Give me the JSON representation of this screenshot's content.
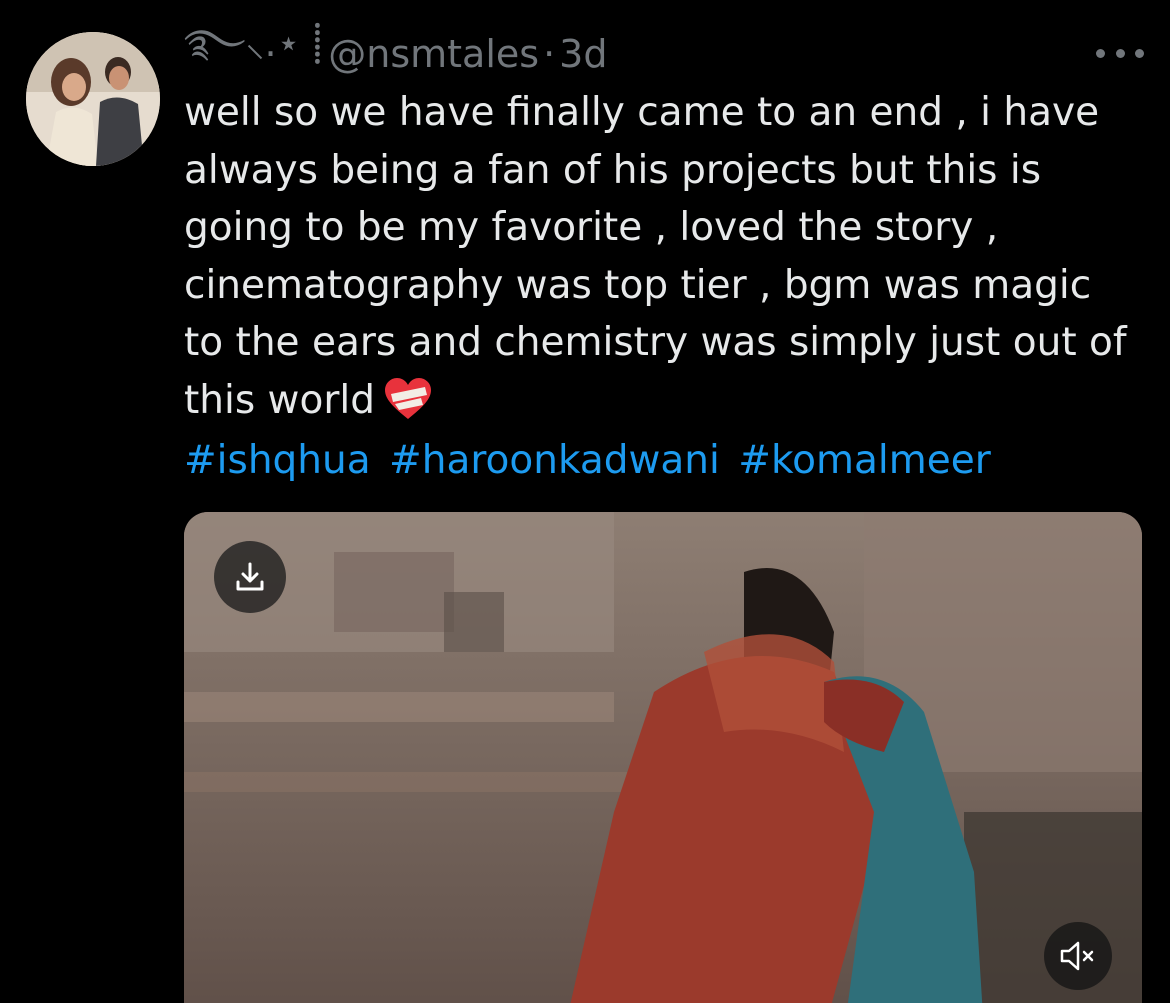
{
  "tweet": {
    "display_name": "࿐⸜.⋆ ⸽",
    "handle": "@nsmtales",
    "separator": "·",
    "time": "3d",
    "text_lines": [
      "well so we have finally came to an end , i have",
      "always being a fan of his projects but this is",
      "going to be my favorite , loved the story ,",
      "cinematography was top tier , bgm was magic",
      "to the ears and chemistry was simply just out of",
      "this world"
    ],
    "emoji": "mending-heart",
    "hashtags": [
      "#ishqhua",
      "#haroonkadwani",
      "#komalmeer"
    ]
  },
  "icons": {
    "more": "more-horizontal-icon",
    "download": "download-icon",
    "mute": "volume-muted-icon"
  },
  "colors": {
    "background": "#000000",
    "text": "#e7e9ea",
    "secondary": "#71767b",
    "link": "#1d9bf0"
  }
}
